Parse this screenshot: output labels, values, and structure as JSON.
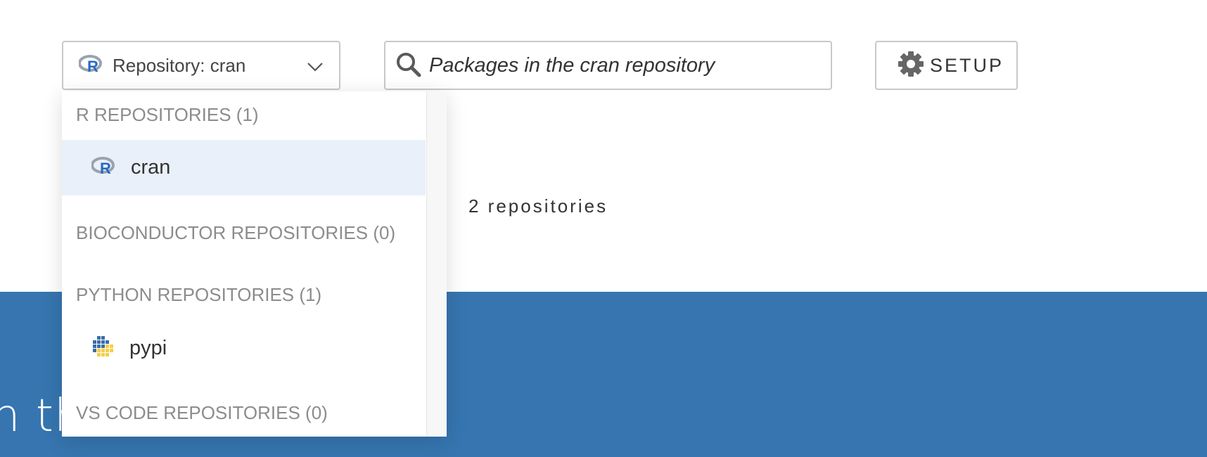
{
  "repository_select": {
    "label": "Repository: cran",
    "logo": "r-logo-icon",
    "arrow": "chevron-down-icon"
  },
  "search": {
    "placeholder": "Packages in the cran repository",
    "icon": "search-icon"
  },
  "setup_button": {
    "label": "SETUP",
    "icon": "gear-icon"
  },
  "repo_count": "2 repositories",
  "hero": {
    "text": "n th"
  },
  "dropdown": {
    "groups": [
      {
        "label": "R REPOSITORIES (1)",
        "options": [
          {
            "label": "cran",
            "icon": "r-logo-icon",
            "selected": true
          }
        ]
      },
      {
        "label": "BIOCONDUCTOR REPOSITORIES (0)",
        "options": []
      },
      {
        "label": "PYTHON REPOSITORIES (1)",
        "options": [
          {
            "label": "pypi",
            "icon": "python-logo-icon",
            "selected": false
          }
        ]
      },
      {
        "label": "VS CODE REPOSITORIES (0)",
        "options": []
      }
    ]
  },
  "colors": {
    "hero_background": "#3675b0",
    "selected_option": "#e9f0f9",
    "group_label": "#8c8c8c",
    "border": "#c8c8c8"
  }
}
